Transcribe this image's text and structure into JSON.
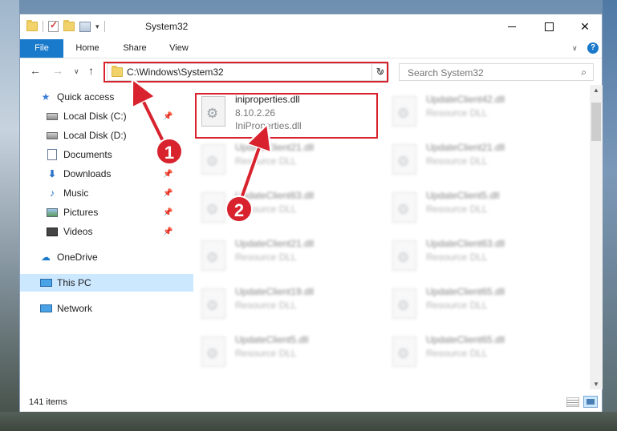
{
  "window": {
    "title": "System32",
    "controls": [
      "minimize-icon",
      "maximize-icon",
      "close-icon"
    ]
  },
  "ribbon": {
    "tabs": [
      {
        "label": "File",
        "active": true
      },
      {
        "label": "Home"
      },
      {
        "label": "Share"
      },
      {
        "label": "View"
      }
    ],
    "help": "?"
  },
  "navigation": {
    "address": "C:\\Windows\\System32",
    "search_placeholder": "Search System32"
  },
  "sidebar": {
    "quick_access": {
      "label": "Quick access",
      "items": [
        {
          "label": "Local Disk (C:)",
          "pinned": true
        },
        {
          "label": "Local Disk (D:)",
          "pinned": false
        },
        {
          "label": "Documents",
          "pinned": false
        },
        {
          "label": "Downloads",
          "pinned": true
        },
        {
          "label": "Music",
          "pinned": true
        },
        {
          "label": "Pictures",
          "pinned": true
        },
        {
          "label": "Videos",
          "pinned": true
        }
      ]
    },
    "onedrive": "OneDrive",
    "this_pc": "This PC",
    "network": "Network"
  },
  "files": [
    {
      "name": "iniproperties.dll",
      "version": "8.10.2.26",
      "desc": "IniProperties.dll"
    },
    {
      "name": "UpdateClient42.dll",
      "desc": "Resource DLL"
    },
    {
      "name": "UpdateClient21.dll",
      "desc": "Resource DLL"
    },
    {
      "name": "UpdateClient21.dll",
      "desc": "Resource DLL"
    },
    {
      "name": "UpdateClient63.dll",
      "desc": "Resource DLL"
    },
    {
      "name": "UpdateClient5.dll",
      "desc": "Resource DLL"
    },
    {
      "name": "UpdateClient21.dll",
      "desc": "Resource DLL"
    },
    {
      "name": "UpdateClient63.dll",
      "desc": "Resource DLL"
    },
    {
      "name": "UpdateClient19.dll",
      "desc": "Resource DLL"
    },
    {
      "name": "UpdateClient65.dll",
      "desc": "Resource DLL"
    },
    {
      "name": "UpdateClient5.dll",
      "desc": "Resource DLL"
    },
    {
      "name": "UpdateClient65.dll",
      "desc": "Resource DLL"
    }
  ],
  "status": {
    "item_count": "141 items"
  },
  "annotations": {
    "callout_1": "1",
    "callout_2": "2",
    "color": "#d8222d"
  }
}
